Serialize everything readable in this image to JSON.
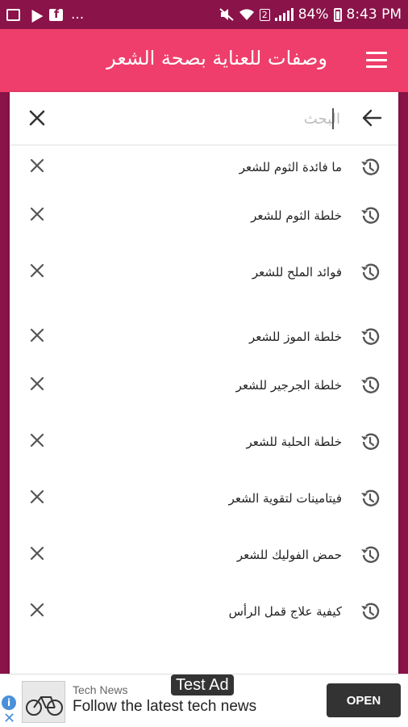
{
  "status_bar": {
    "battery": "84%",
    "time": "8:43 PM",
    "sim": "2",
    "more": "..."
  },
  "app_bar": {
    "title": "وصفات للعناية بصحة الشعر"
  },
  "search": {
    "placeholder": "البحث",
    "value": ""
  },
  "history": [
    {
      "label": "ما فائدة الثوم للشعر"
    },
    {
      "label": "خلطة الثوم للشعر"
    },
    {
      "label": "فوائد الملح للشعر"
    },
    {
      "label": "خلطة الموز للشعر"
    },
    {
      "label": "خلطة الجرجير للشعر"
    },
    {
      "label": "خلطة الحلبة للشعر"
    },
    {
      "label": "فيتامينات لتقوية الشعر"
    },
    {
      "label": "حمض الفوليك للشعر"
    },
    {
      "label": "كيفية علاج قمل الرأس"
    }
  ],
  "ad": {
    "badge": "Test Ad",
    "source": "Tech News",
    "text": "Follow the latest tech news",
    "button": "OPEN",
    "info": "i",
    "close": "✕"
  },
  "colors": {
    "app_bar": "#ef3e6b",
    "status_bar": "#8a1349"
  }
}
